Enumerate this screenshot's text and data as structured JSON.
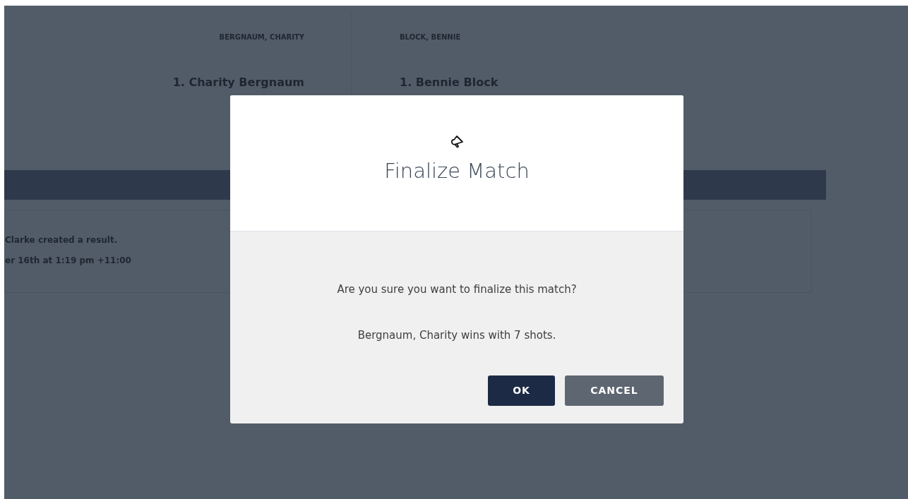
{
  "background": {
    "teams": [
      {
        "header": "BERGNAUM, CHARITY",
        "player": "1. Charity Bergnaum"
      },
      {
        "header": "BLOCK, BENNIE",
        "player": "1. Bennie Block"
      }
    ],
    "activity": {
      "message": "Clarke created a result.",
      "time": "er 16th at 1:19 pm +11:00"
    }
  },
  "modal": {
    "title": "Finalize Match",
    "question": "Are you sure you want to finalize this match?",
    "summary": "Bergnaum, Charity wins with 7 shots.",
    "buttons": [
      {
        "label": "OK",
        "kind": "primary"
      },
      {
        "label": "CANCEL",
        "kind": "secondary"
      }
    ]
  }
}
